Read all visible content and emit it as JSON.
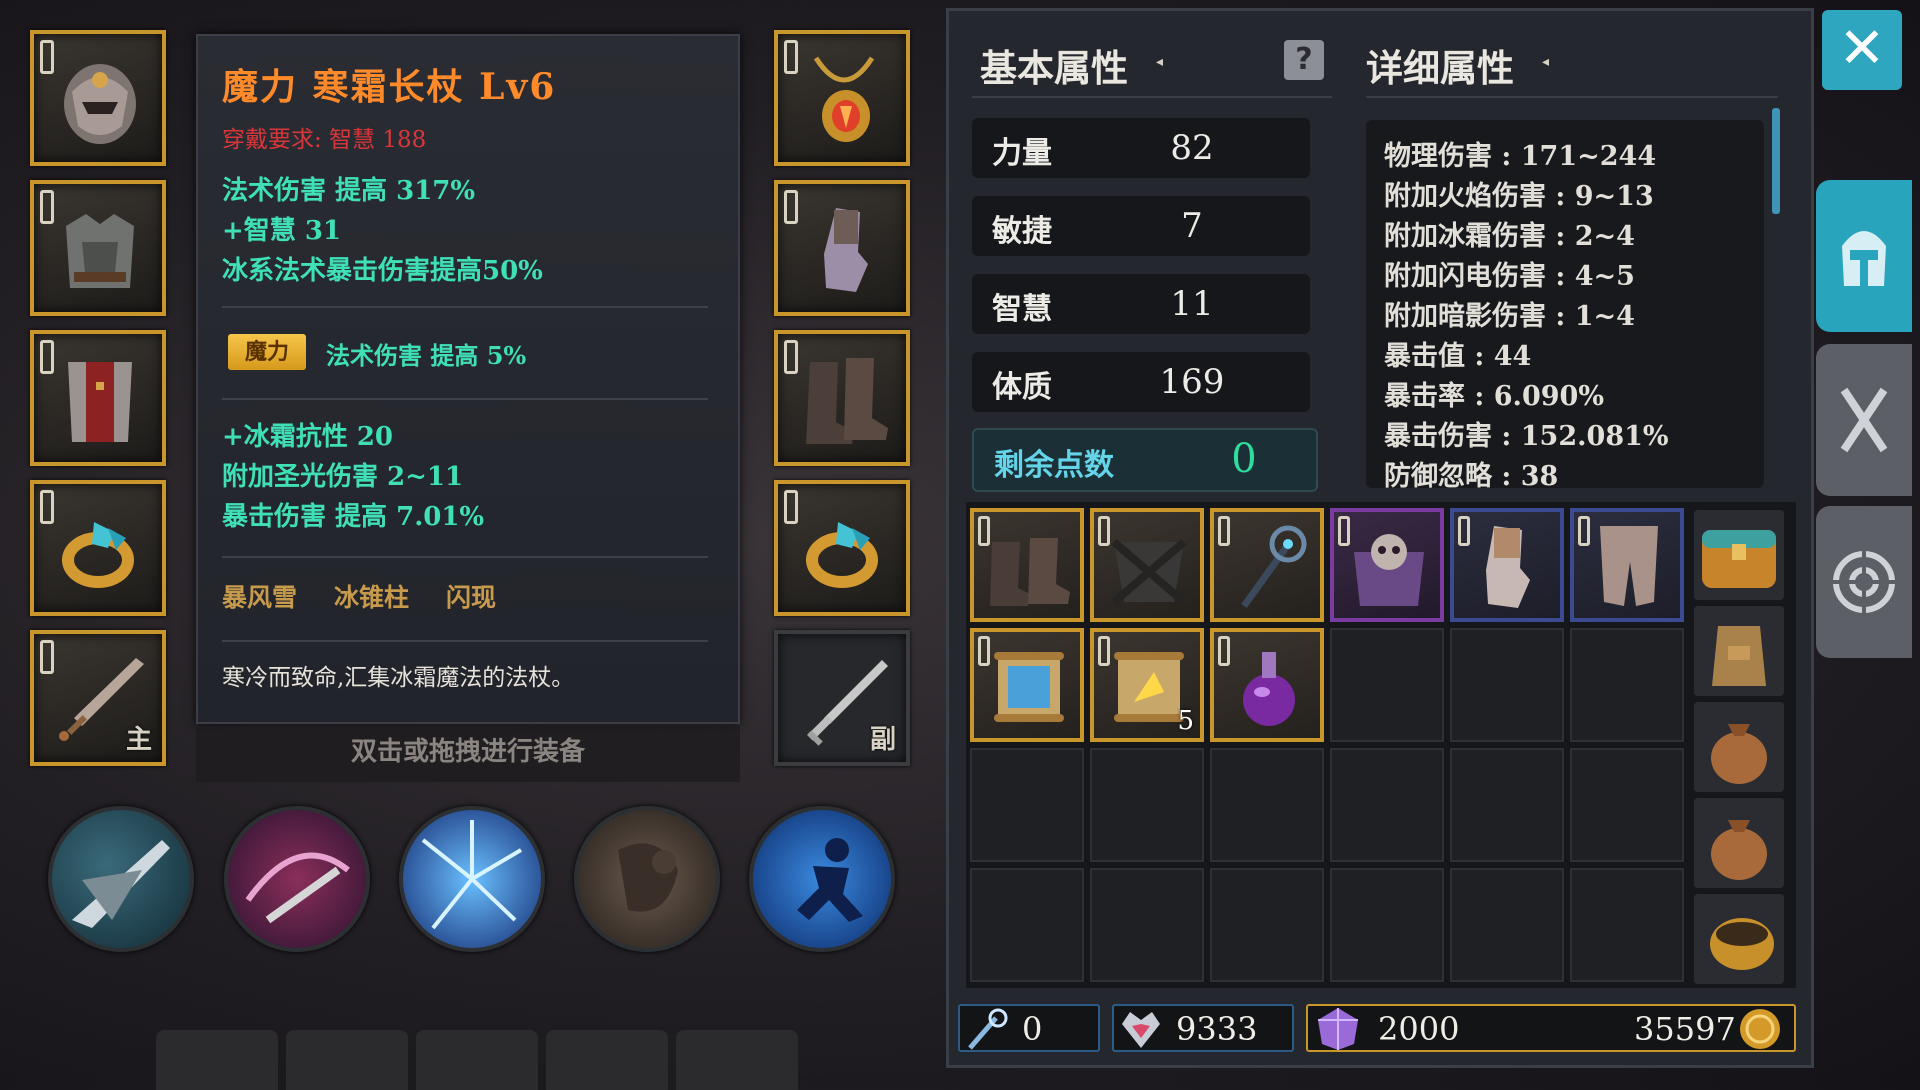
{
  "equipment": {
    "left_slots": [
      {
        "name": "helmet",
        "tag": ""
      },
      {
        "name": "chest-armor",
        "tag": ""
      },
      {
        "name": "leg-armor",
        "tag": ""
      },
      {
        "name": "ring-left",
        "tag": ""
      },
      {
        "name": "main-weapon",
        "tag": "主"
      }
    ],
    "right_slots": [
      {
        "name": "necklace",
        "tag": ""
      },
      {
        "name": "gloves",
        "tag": ""
      },
      {
        "name": "boots",
        "tag": ""
      },
      {
        "name": "ring-right",
        "tag": ""
      },
      {
        "name": "off-weapon",
        "tag": "副"
      }
    ]
  },
  "tooltip": {
    "title": "魔力 寒霜长杖 Lv6",
    "requirement": "穿戴要求:   智慧 188",
    "stats": [
      "法术伤害 提高 317%",
      "+智慧 31",
      "冰系法术暴击伤害提高50%"
    ],
    "bonus_badge": "魔力",
    "bonus_text": "法术伤害 提高 5%",
    "extra_stats": [
      "+冰霜抗性 20",
      "附加圣光伤害 2~11",
      "暴击伤害 提高 7.01%"
    ],
    "skills": [
      "暴风雪",
      "冰锥柱",
      "闪现"
    ],
    "description": "寒冷而致命,汇集冰霜魔法的法杖。"
  },
  "hint": "双击或拖拽进行装备",
  "skills_bar": [
    "slash-skill",
    "whirl-skill",
    "frost-nova-skill",
    "charge-skill",
    "dash-skill"
  ],
  "panel": {
    "basic_title": "基本属性",
    "detail_title": "详细属性",
    "help_label": "?",
    "basic_stats": [
      {
        "label": "力量",
        "value": "82"
      },
      {
        "label": "敏捷",
        "value": "7"
      },
      {
        "label": "智慧",
        "value": "11"
      },
      {
        "label": "体质",
        "value": "169"
      }
    ],
    "remaining": {
      "label": "剩余点数",
      "value": "0"
    },
    "detail_stats": [
      "物理伤害 : 171~244",
      "附加火焰伤害 : 9~13",
      "附加冰霜伤害 : 2~4",
      "附加闪电伤害 : 4~5",
      "附加暗影伤害 : 1~4",
      "暴击值 : 44",
      "暴击率 : 6.090%",
      "暴击伤害 : 152.081%",
      "防御忽略 : 38"
    ]
  },
  "inventory": {
    "row1": [
      "boots",
      "shoulder-armor",
      "staff",
      "skull-armor",
      "gloves",
      "leg-armor"
    ],
    "row2": [
      {
        "item": "scroll-blue",
        "count": ""
      },
      {
        "item": "scroll-gold",
        "count": "5"
      },
      {
        "item": "purple-potion",
        "count": ""
      }
    ]
  },
  "currency": {
    "staff_points": "0",
    "crystal_hearts": "9333",
    "gems": "2000",
    "gold": "35597"
  },
  "close_label": "✕",
  "colors": {
    "accent": "#2ea6bf",
    "gold_border": "#c8962b",
    "tooltip_title": "#ff8a2a",
    "stat_green": "#3fe0b6"
  }
}
